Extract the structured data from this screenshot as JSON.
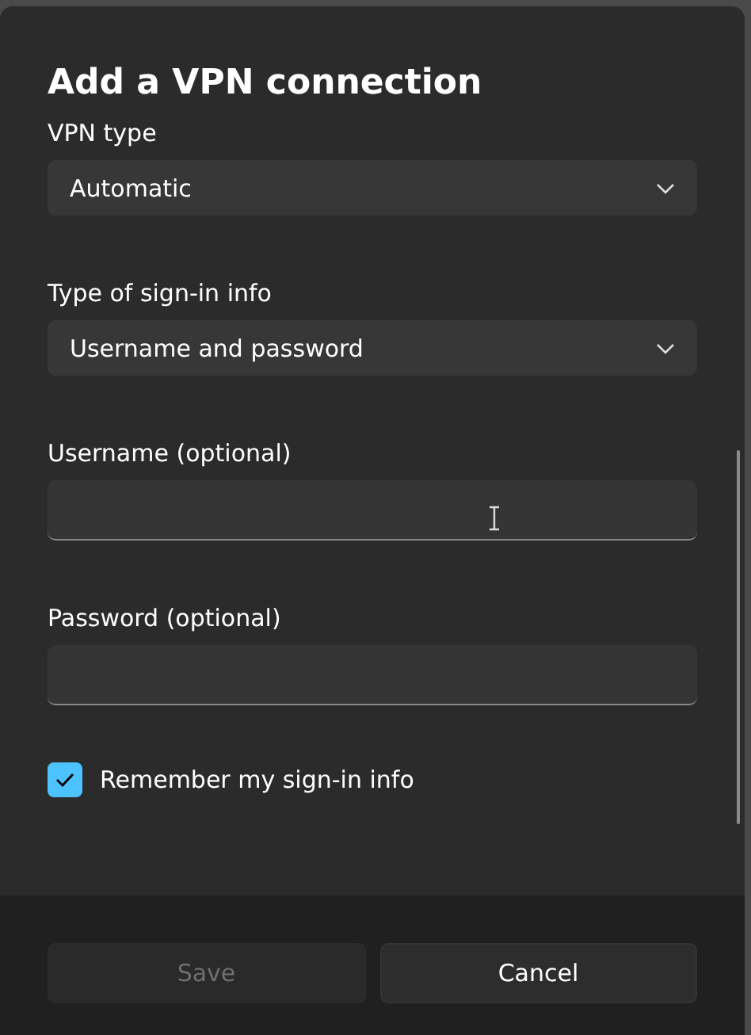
{
  "dialog": {
    "title": "Add a VPN connection"
  },
  "fields": [
    {
      "kind": "dropdown",
      "label": "VPN type",
      "value": "Automatic"
    },
    {
      "kind": "dropdown",
      "label": "Type of sign-in info",
      "value": "Username and password"
    },
    {
      "kind": "text",
      "label": "Username (optional)"
    },
    {
      "kind": "text",
      "label": "Password (optional)"
    }
  ],
  "remember": {
    "label": "Remember my sign-in info",
    "checked": true
  },
  "buttons": [
    {
      "label": "Save",
      "disabled": true
    },
    {
      "label": "Cancel",
      "disabled": false
    }
  ]
}
